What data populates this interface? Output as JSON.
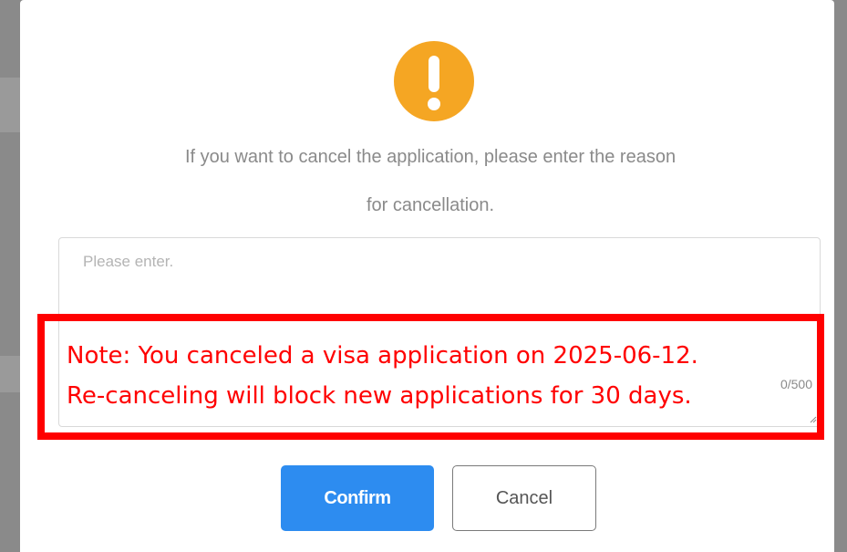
{
  "dialog": {
    "message_line1": "If you want to cancel the application, please enter the reason",
    "message_line2": "for cancellation.",
    "reason_input": {
      "placeholder": "Please enter.",
      "value": "",
      "counter": "0/500"
    },
    "note": {
      "line1": "Note: You canceled a visa application on 2025-06-12.",
      "line2": "Re-canceling will block new applications for 30 days."
    },
    "confirm_label": "Confirm",
    "cancel_label": "Cancel"
  },
  "colors": {
    "warning": "#f5a623",
    "primary": "#2d8cf0",
    "note": "#ff0000"
  },
  "icons": {
    "warning": "warning-icon"
  }
}
